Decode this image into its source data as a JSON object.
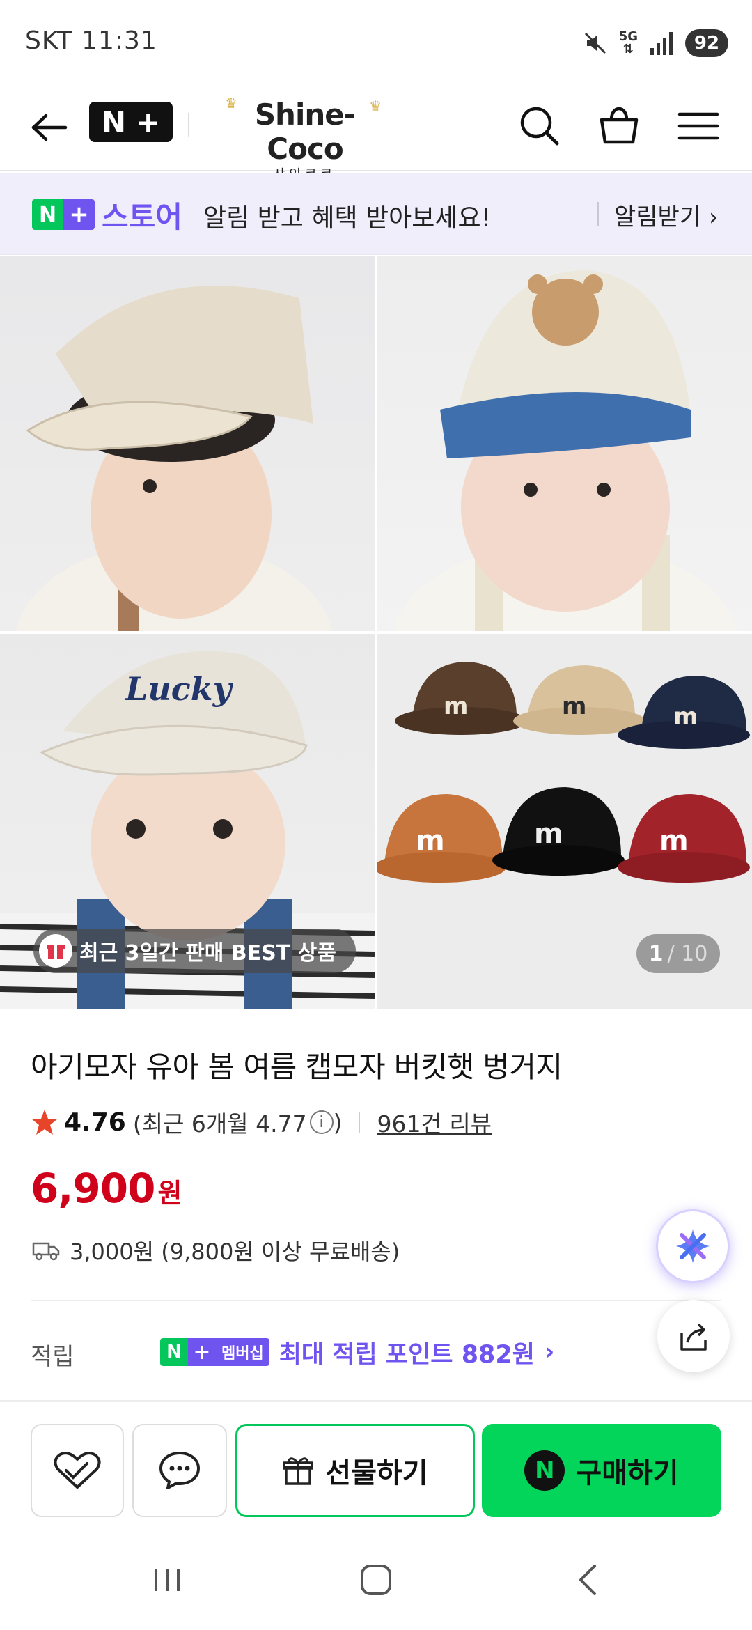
{
  "status": {
    "time": "SKT 11:31",
    "battery": "92"
  },
  "header": {
    "brand_name": "Shine-Coco",
    "brand_sub": "샤인코코"
  },
  "banner": {
    "store": "스토어",
    "message": "알림 받고 혜택 받아보세요!",
    "cta": "알림받기"
  },
  "gallery": {
    "badge": "최근 3일간 판매 BEST 상품",
    "current": "1",
    "total": "/ 10"
  },
  "product": {
    "title": "아기모자 유아 봄 여름 캡모자 버킷햇 벙거지",
    "rating": "4.76",
    "recent_rating": "(최근 6개월 4.77",
    "recent_rating_close": ")",
    "reviews": "961건 리뷰",
    "price": "6,900",
    "currency": "원",
    "shipping": "3,000원 (9,800원 이상 무료배송)",
    "reward_label": "적립",
    "membership": "멤버십",
    "reward_text": "최대 적립 포인트 882원"
  },
  "bottom": {
    "gift": "선물하기",
    "buy": "구매하기"
  },
  "colors": {
    "naver_green": "#03c75a",
    "naver_purple": "#6f54f0",
    "price_red": "#d0021b"
  }
}
